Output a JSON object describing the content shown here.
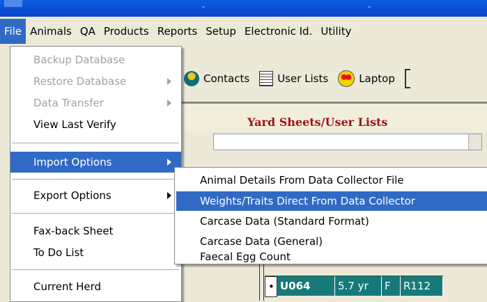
{
  "menubar": {
    "items": [
      {
        "label": "File",
        "active": true
      },
      {
        "label": "Animals"
      },
      {
        "label": "QA"
      },
      {
        "label": "Products"
      },
      {
        "label": "Reports"
      },
      {
        "label": "Setup"
      },
      {
        "label": "Electronic Id."
      },
      {
        "label": "Utility"
      }
    ]
  },
  "toolbar": {
    "contacts_label": "Contacts",
    "userlists_label": "User Lists",
    "laptop_label": "Laptop"
  },
  "panel": {
    "title": "Yard Sheets/User Lists"
  },
  "grid": {
    "row": {
      "tag": "U064",
      "age": "5.7 yr",
      "sex": "F",
      "code": "R112"
    }
  },
  "file_menu": {
    "items": {
      "backup": "Backup Database",
      "restore": "Restore Database",
      "transfer": "Data Transfer",
      "verify": "View Last Verify",
      "import": "Import Options",
      "export": "Export Options",
      "faxback": "Fax-back Sheet",
      "todo": "To Do List",
      "herd": "Current Herd"
    }
  },
  "import_submenu": {
    "items": [
      "Animal Details From Data Collector File",
      "Weights/Traits Direct From Data Collector",
      "Carcase Data (Standard Format)",
      "Carcase Data (General)",
      "Faecal Egg Count"
    ]
  },
  "colors": {
    "highlight": "#316ac5",
    "menu_bg": "#ece9d8",
    "title_red": "#9b1414",
    "grid_teal": "#177a7a"
  }
}
